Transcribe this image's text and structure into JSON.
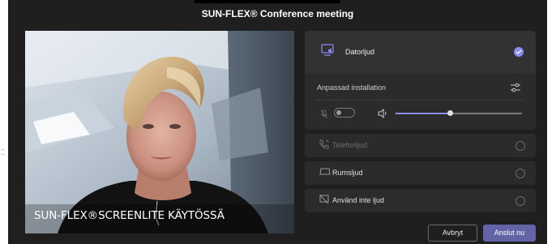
{
  "window": {
    "title": "SUN-FLEX® Conference meeting"
  },
  "edge_glyphs": "··\n··",
  "video": {
    "caption": "SUN-FLEX®SCREENLITE KÄYTÖSSÄ"
  },
  "audio_options": [
    {
      "label": "Datorljud",
      "selected": true,
      "icon": "computer-audio-icon"
    },
    {
      "label": "Telefonljud",
      "selected": false,
      "enabled": false,
      "icon": "phone-icon"
    },
    {
      "label": "Rumsljud",
      "selected": false,
      "enabled": true,
      "icon": "room-audio-icon"
    },
    {
      "label": "Använd inte ljud",
      "selected": false,
      "enabled": true,
      "icon": "no-audio-icon"
    }
  ],
  "custom_setup": {
    "label": "Anpassad installation",
    "icon": "settings-sliders-icon"
  },
  "controls": {
    "mic_icon": "mic-muted-icon",
    "mic_enabled": false,
    "volume_icon": "speaker-icon",
    "volume_level": 0.43
  },
  "buttons": {
    "cancel": "Avbryt",
    "join": "Anslut nu"
  },
  "colors": {
    "accent": "#6264a7",
    "check": "#8b8cf0",
    "background": "#1f1f1f",
    "panel": "#2b2b2b"
  }
}
